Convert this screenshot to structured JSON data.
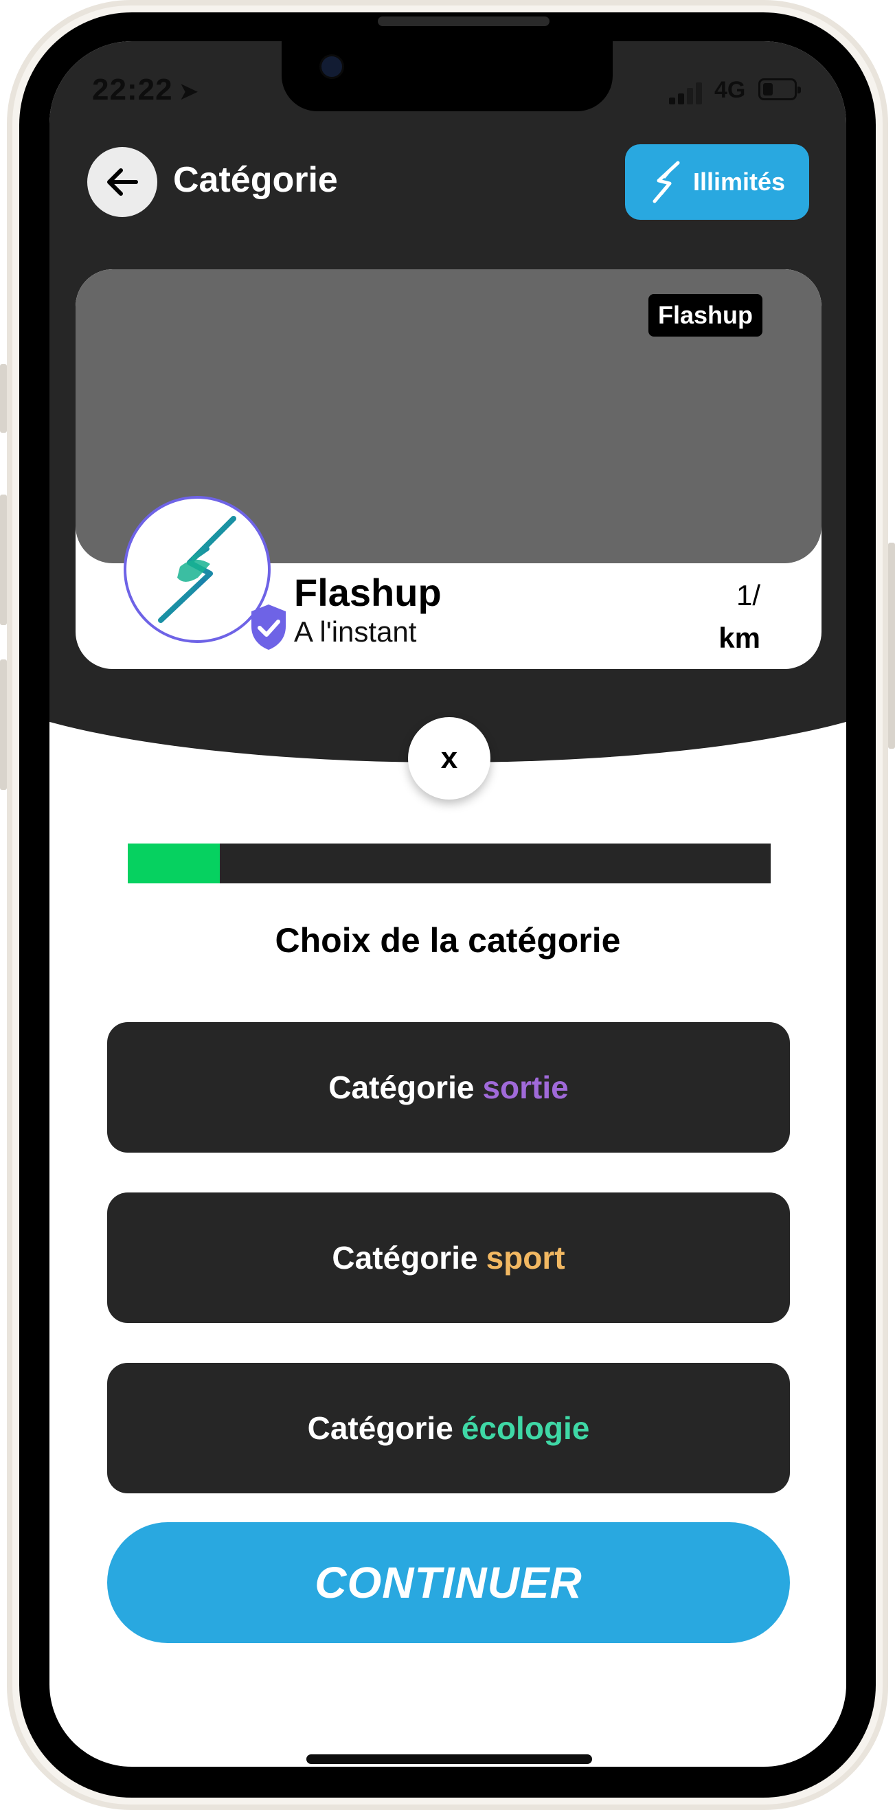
{
  "status_bar": {
    "time": "22:22",
    "network": "4G"
  },
  "header": {
    "title": "Catégorie",
    "unlimited_label": "Illimités"
  },
  "card": {
    "tag": "Flashup",
    "name": "Flashup",
    "time": "A l'instant",
    "distance_value": "1/",
    "distance_unit": "km"
  },
  "close_label": "x",
  "progress": {
    "fraction": 0.143
  },
  "section_title": "Choix de la catégorie",
  "categories": [
    {
      "prefix": "Catégorie",
      "keyword": "sortie",
      "color": "#a06ad9"
    },
    {
      "prefix": "Catégorie",
      "keyword": "sport",
      "color": "#f2b862"
    },
    {
      "prefix": "Catégorie",
      "keyword": "écologie",
      "color": "#3fd8a6"
    }
  ],
  "continue_label": "CONTINUER",
  "colors": {
    "accent": "#29a8e0",
    "dark": "#262626",
    "progress": "#06d160"
  }
}
